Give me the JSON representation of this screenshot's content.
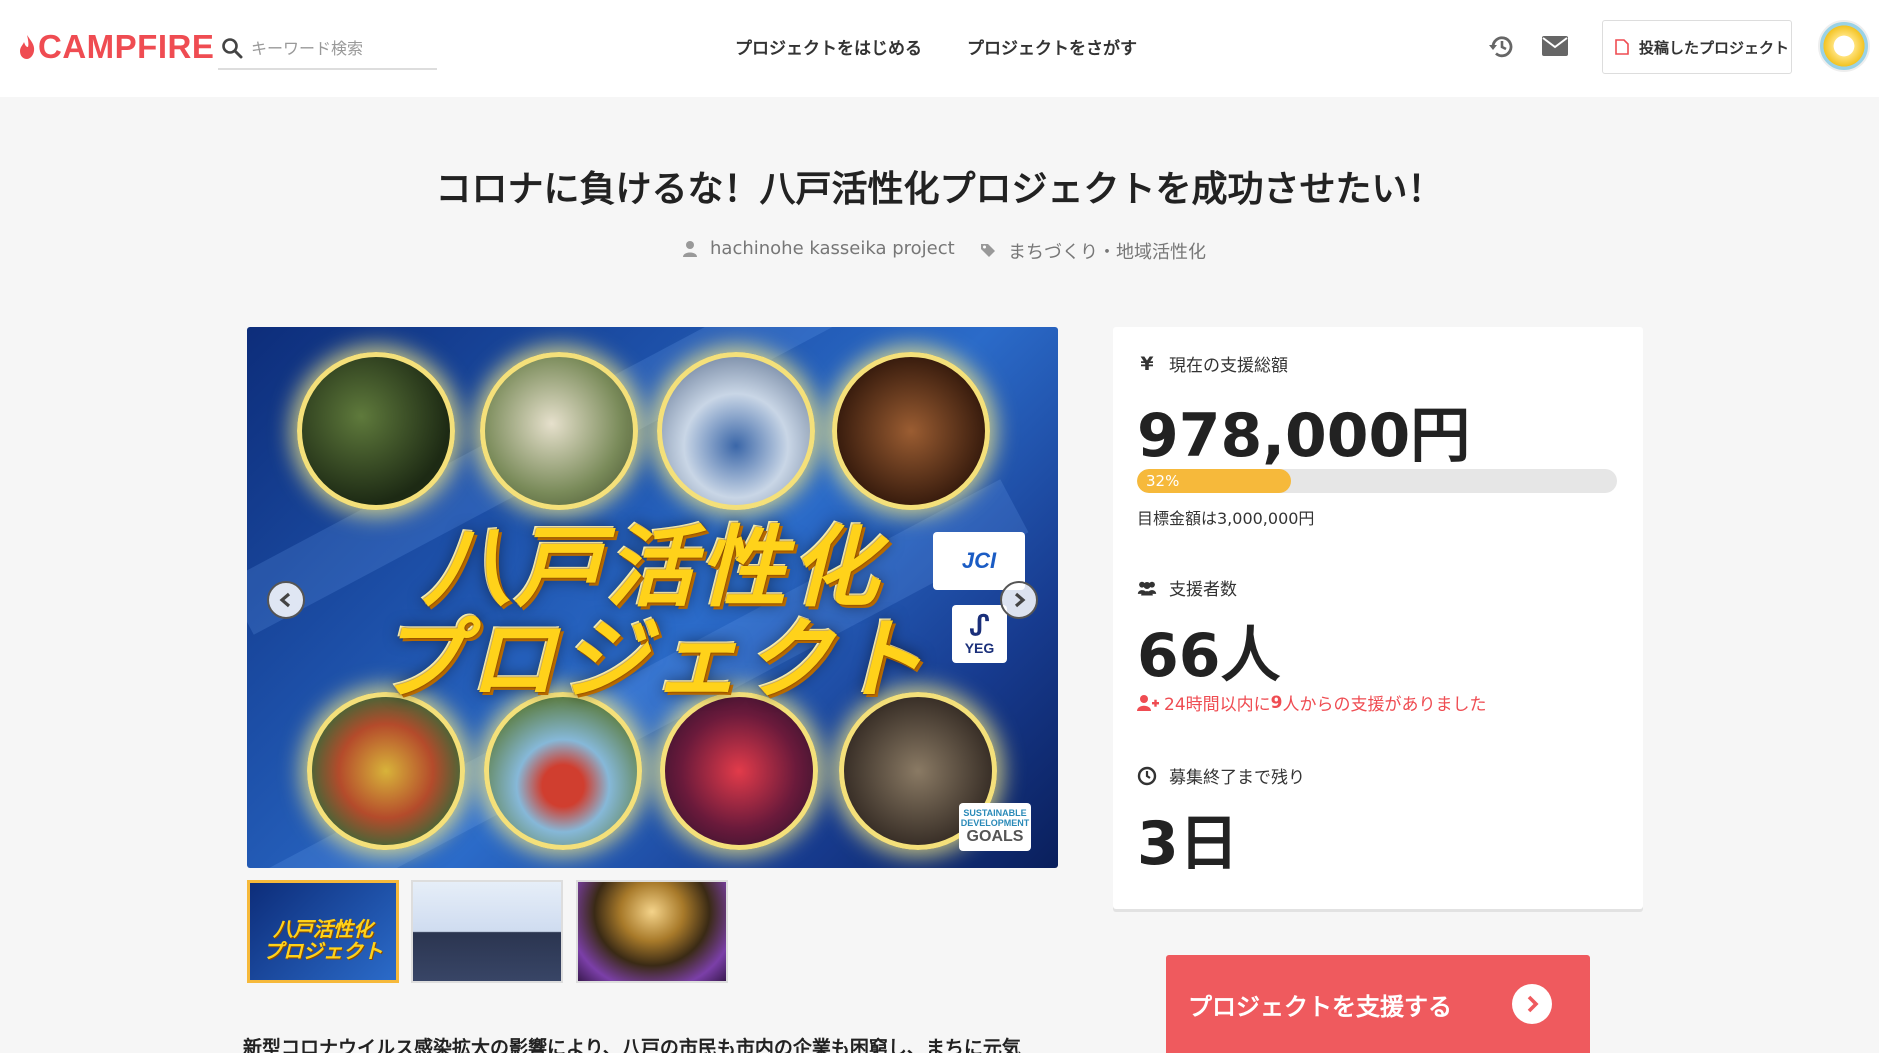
{
  "header": {
    "logo_text": "CAMPFIRE",
    "search_placeholder": "キーワード検索",
    "nav": [
      "プロジェクトをはじめる",
      "プロジェクトをさがす"
    ],
    "posted_projects_label": "投稿したプロジェクト"
  },
  "project": {
    "title": "コロナに負けるな！八戸活性化プロジェクトを成功させたい！",
    "owner": "hachinohe kasseika project",
    "category": "まちづくり・地域活性化",
    "hero_text_line1": "八戸活性化",
    "hero_text_line2": "プロジェクト",
    "badges": {
      "jci": "JCI",
      "yeg": "YEG",
      "sdg_line1": "SUSTAINABLE",
      "sdg_line2": "DEVELOPMENT",
      "sdg_line3": "GOALS"
    },
    "description_start": "新型コロナウイルス感染拡大の影響により、八戸の市民も市内の企業も困窮し、まちに元気"
  },
  "stats": {
    "amount_label": "現在の支援総額",
    "amount": "978,000円",
    "progress_percent": 32,
    "progress_text": "32%",
    "goal_text": "目標金額は3,000,000円",
    "backers_label": "支援者数",
    "backers": "66人",
    "recent_prefix": "24時間以内に",
    "recent_count": "9",
    "recent_suffix": "人からの支援がありました",
    "remaining_label": "募集終了まで残り",
    "remaining": "3日"
  },
  "cta": {
    "support_label": "プロジェクトを支援する"
  },
  "colors": {
    "brand": "#ef4c52",
    "progress": "#f6b93b",
    "cta": "#ef5a5e"
  }
}
